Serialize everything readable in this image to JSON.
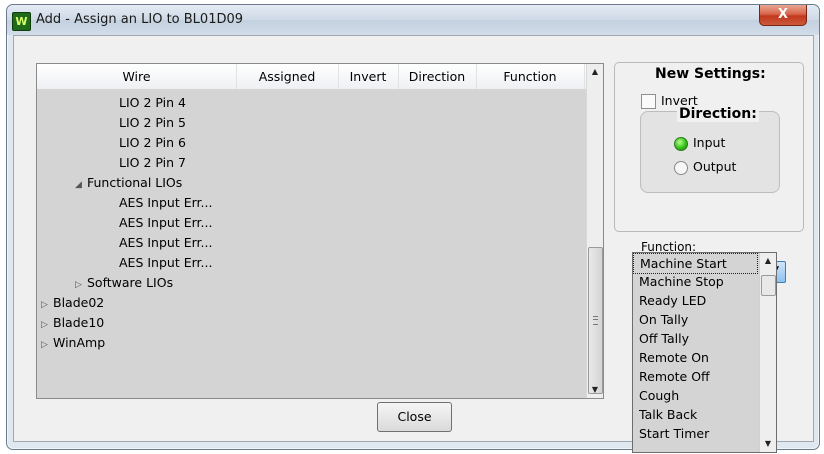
{
  "window": {
    "title": "Add - Assign an LIO to BL01D09",
    "app_icon_letter": "W",
    "close_glyph": "X"
  },
  "list": {
    "columns": [
      "Wire",
      "Assigned",
      "Invert",
      "Direction",
      "Function"
    ],
    "rows": [
      {
        "text": "LIO 2 Pin 4",
        "expander": ""
      },
      {
        "text": "LIO 2 Pin 5",
        "expander": ""
      },
      {
        "text": "LIO 2 Pin 6",
        "expander": ""
      },
      {
        "text": "LIO 2 Pin 7",
        "expander": ""
      },
      {
        "text": "Functional LIOs",
        "expander": "◢"
      },
      {
        "text": "AES Input Err...",
        "expander": ""
      },
      {
        "text": "AES Input Err...",
        "expander": ""
      },
      {
        "text": "AES Input Err...",
        "expander": ""
      },
      {
        "text": "AES Input Err...",
        "expander": ""
      },
      {
        "text": "Software LIOs",
        "expander": "▷"
      },
      {
        "text": "Blade02",
        "expander": "▷"
      },
      {
        "text": "Blade10",
        "expander": "▷"
      },
      {
        "text": "WinAmp",
        "expander": "▷"
      }
    ]
  },
  "settings": {
    "title": "New Settings:",
    "invert_label": "Invert",
    "invert_checked": false,
    "direction_title": "Direction:",
    "input_label": "Input",
    "output_label": "Output",
    "direction_selected": "Input",
    "function_label": "Function:",
    "function_value": "",
    "function_options": [
      "Machine Start",
      "Machine Stop",
      "Ready LED",
      "On Tally",
      "Off Tally",
      "Remote On",
      "Remote Off",
      "Cough",
      "Talk Back",
      "Start Timer"
    ]
  },
  "buttons": {
    "close_label": "Close"
  },
  "icons": {
    "scroll_up": "▲",
    "scroll_down": "▼",
    "combo_arrow": "▼"
  },
  "colors": {
    "accent_green": "#34c21a",
    "combo_blue": "#8cc1f0",
    "close_red": "#c2381c"
  }
}
